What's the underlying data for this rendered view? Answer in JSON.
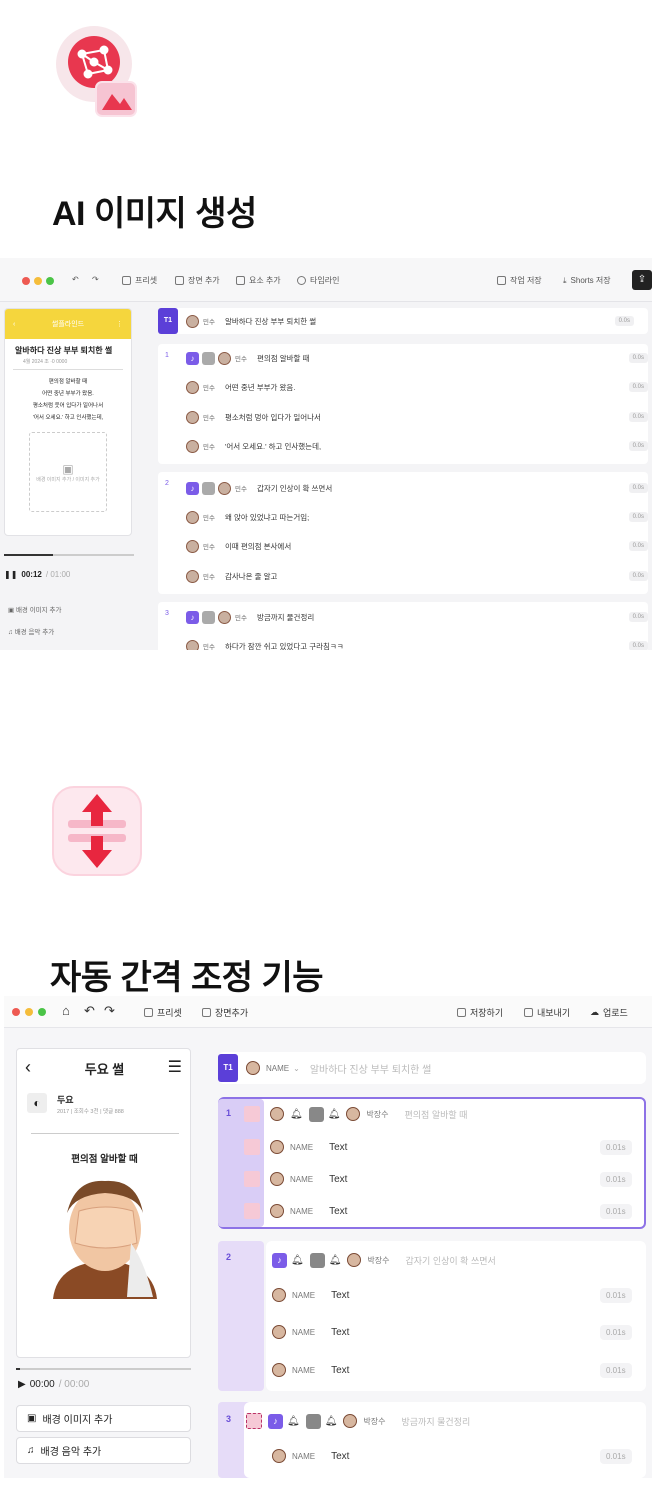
{
  "section1": {
    "title": "AI 이미지 생성",
    "toolbar": {
      "preset": "프리셋",
      "add_scene": "장면 추가",
      "add_element": "요소 추가",
      "timeline": "타임라인",
      "save_work": "작업 저장",
      "save_shorts": "Shorts 저장"
    },
    "phone": {
      "header": "썰플라인드",
      "title": "알바하다 진상 부부 퇴치한 썰",
      "meta": "4월 2024 조 ·0 0000",
      "body": [
        "편의점 알바할 때",
        "어떤 중년 부부가 왔음.",
        "평소처럼 웃어 입다가 일어나서",
        "'어서 오세요.' 하고 인사했는데,"
      ],
      "image_placeholder": "배경 이미지 추가 / 이미지 추가",
      "time": "00:12",
      "total": "/ 01:00",
      "bg_image": "배경 이미지 추가",
      "bg_music": "배경 음악 추가"
    },
    "title_row": {
      "tag": "T1",
      "name": "민수",
      "text": "알바하다 진상 부부 퇴치한 썰",
      "dur": "0.0s"
    },
    "scenes": [
      {
        "num": "1",
        "rows": [
          {
            "name": "민수",
            "text": "편의점 알바할 때"
          },
          {
            "name": "민수",
            "text": "어떤 중년 부부가 왔음."
          },
          {
            "name": "민수",
            "text": "평소처럼 멍아 입다가 일어나서"
          },
          {
            "name": "민수",
            "text": "'어서 오세요.' 하고 인사했는데,"
          }
        ]
      },
      {
        "num": "2",
        "rows": [
          {
            "name": "민수",
            "text": "갑자기 인상이 확 쓰면서"
          },
          {
            "name": "민수",
            "text": "왜 앉아 있었냐고 따는거임;"
          },
          {
            "name": "민수",
            "text": "이때 편의점 본사에서"
          },
          {
            "name": "민수",
            "text": "감사나온 줄 알고"
          }
        ]
      },
      {
        "num": "3",
        "rows": [
          {
            "name": "민수",
            "text": "방금까지 물건정리"
          },
          {
            "name": "민수",
            "text": "하다가 잠깐 쉬고 있었다고 구라침ㅋㅋ"
          }
        ]
      }
    ],
    "dur": "0.0s"
  },
  "section2": {
    "title": "자동 간격 조정 기능",
    "toolbar": {
      "preset": "프리셋",
      "add_scene": "장면추가",
      "save": "저장하기",
      "export": "내보내기",
      "upload": "업로드"
    },
    "phone": {
      "title": "두요 썰",
      "channel": "두요",
      "meta": "2017 | 조회수 3천 | 댓글 888",
      "caption": "편의점 알바할 때",
      "time": "00:00",
      "total": "/ 00:00",
      "bg_image": "배경 이미지 추가",
      "bg_music": "배경 음악 추가"
    },
    "title_row": {
      "tag": "T1",
      "name": "NAME",
      "text": "알바하다 진상 부부 퇴치한 썰"
    },
    "scenes": [
      {
        "num": "1",
        "head_name": "박장수",
        "head_text": "편의점 알바할 때",
        "rows": [
          "Text",
          "Text",
          "Text"
        ]
      },
      {
        "num": "2",
        "head_name": "박장수",
        "head_text": "갑자기 인상이 확 쓰면서",
        "rows": [
          "Text",
          "Text",
          "Text"
        ]
      },
      {
        "num": "3",
        "head_name": "박장수",
        "head_text": "방금까지 물건정리",
        "rows": [
          "Text"
        ]
      }
    ],
    "row_name": "NAME",
    "dur": "0.01s"
  }
}
